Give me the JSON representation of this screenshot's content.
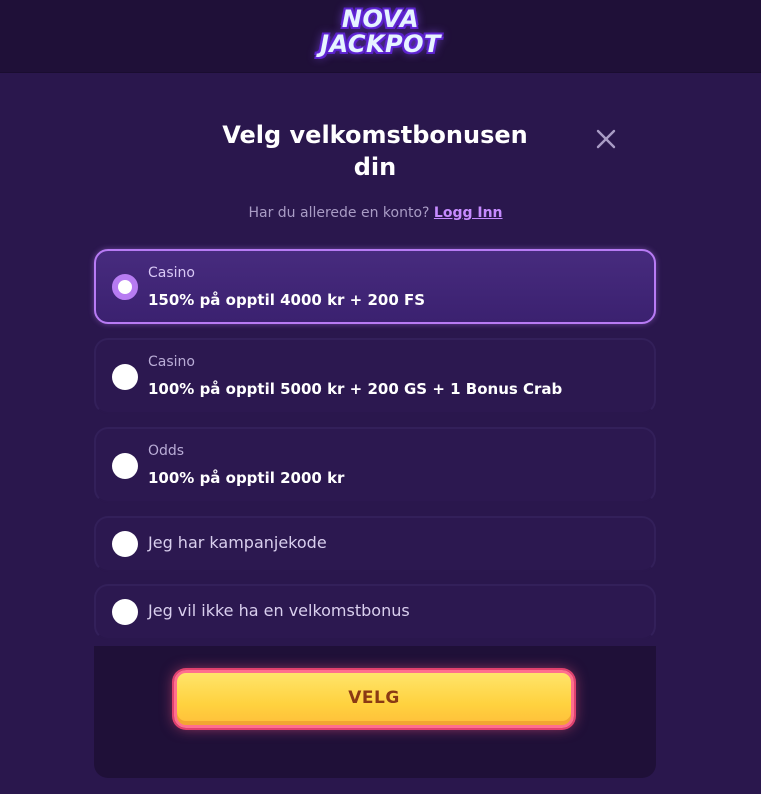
{
  "brand": {
    "logo_line1": "NOVA",
    "logo_line2": "JACKPOT"
  },
  "modal": {
    "title_line1": "Velg velkomstbonusen",
    "title_line2": "din",
    "close_icon": "close-icon",
    "account_prompt": "Har du allerede en konto?",
    "login_link": "Logg Inn"
  },
  "options": [
    {
      "category": "Casino",
      "label": "150% på opptil 4000 kr + 200 FS",
      "selected": true
    },
    {
      "category": "Casino",
      "label": "100% på opptil 5000 kr + 200 GS + 1 Bonus Crab",
      "selected": false
    },
    {
      "category": "Odds",
      "label": "100% på opptil 2000 kr",
      "selected": false
    },
    {
      "label": "Jeg har kampanjekode",
      "selected": false
    },
    {
      "label": "Jeg vil ikke ha en velkomstbonus",
      "selected": false
    }
  ],
  "actions": {
    "confirm_label": "VELG"
  },
  "colors": {
    "background": "#2a174d",
    "header_background": "#1f1038",
    "accent_purple": "#b87bf5",
    "link": "#c68bff",
    "button_yellow": "#ffd23f",
    "button_border": "#ff6f8e",
    "button_text": "#8a3a14"
  }
}
